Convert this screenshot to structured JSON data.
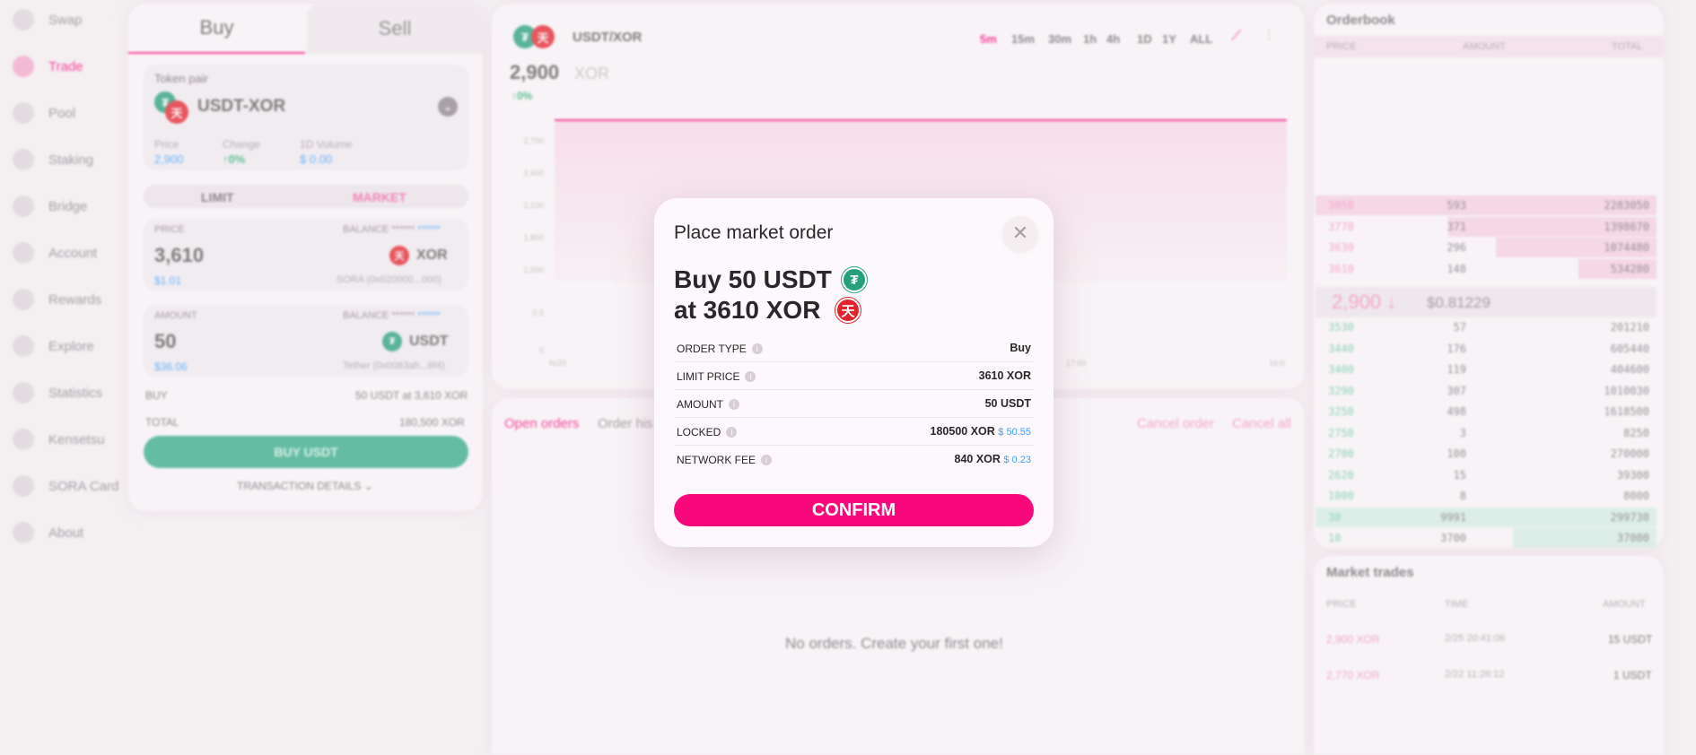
{
  "sidebar": {
    "items": [
      {
        "label": "Swap",
        "icon": "swap-icon"
      },
      {
        "label": "Trade",
        "icon": "trade-icon",
        "active": true
      },
      {
        "label": "Pool",
        "icon": "pool-icon"
      },
      {
        "label": "Staking",
        "icon": "staking-icon"
      },
      {
        "label": "Bridge",
        "icon": "bridge-icon"
      },
      {
        "label": "Account",
        "icon": "account-icon"
      },
      {
        "label": "Rewards",
        "icon": "rewards-icon"
      },
      {
        "label": "Explore",
        "icon": "explore-icon"
      },
      {
        "label": "Statistics",
        "icon": "statistics-icon"
      },
      {
        "label": "Kensetsu",
        "icon": "kensetsu-icon"
      },
      {
        "label": "SORA Card",
        "icon": "card-icon"
      },
      {
        "label": "About",
        "icon": "about-icon"
      }
    ]
  },
  "order_form": {
    "buy_tab": "Buy",
    "sell_tab": "Sell",
    "token_pair_label": "Token pair",
    "token_pair": "USDT-XOR",
    "price_label": "Price",
    "price_value": "2,900",
    "change_label": "Change",
    "change_value": "0%",
    "volume_label": "1D Volume",
    "volume_value": "0.00",
    "volume_prefix": "$",
    "limit_tab": "LIMIT",
    "market_tab": "MARKET",
    "price_field_label": "PRICE",
    "balance_label": "BALANCE",
    "balance_mask": "******",
    "balance_mask_blue": "******",
    "price_input": "3,610",
    "price_usd": "$1.01",
    "price_token": "XOR",
    "price_token_info": "SORA (0x020000...000)",
    "amount_field_label": "AMOUNT",
    "amount_input": "50",
    "amount_usd": "$36.06",
    "amount_token": "USDT",
    "amount_token_info": "Tether (0x0083ah...6f4)",
    "summary_buy_label": "BUY",
    "summary_buy_value": "50 USDT at 3,610 XOR",
    "summary_total_label": "TOTAL",
    "summary_total_value": "180,500 XOR",
    "buy_button": "BUY USDT",
    "transaction_details": "TRANSACTION DETAILS"
  },
  "chart": {
    "pair": "USDT/XOR",
    "price": "2,900",
    "price_unit": "XOR",
    "change": "0%",
    "timeframes": [
      "5m",
      "15m",
      "30m",
      "1h",
      "4h",
      "1D",
      "1Y",
      "ALL"
    ],
    "active_timeframe": "5m",
    "colors": {
      "accent": "#f8087b",
      "fill": "#f6c2d9"
    }
  },
  "chart_data": {
    "type": "area",
    "y_ticks": [
      "2,700",
      "2,400",
      "2,100",
      "1,800",
      "1,500",
      "0.5",
      "0"
    ],
    "x_ticks": [
      "N/20",
      "17:00",
      "16:0"
    ],
    "values": [
      2900,
      2900
    ],
    "title": ""
  },
  "orders": {
    "open_orders_tab": "Open orders",
    "order_history_tab": "Order his",
    "cancel_order": "Cancel order",
    "cancel_all": "Cancel all",
    "empty_text": "No orders. Create your first one!"
  },
  "orderbook": {
    "title": "Orderbook",
    "headers": [
      "PRICE",
      "AMOUNT",
      "TOTAL"
    ],
    "asks": [
      {
        "price": "3850",
        "amount": "593",
        "total": "2283050",
        "depth": 1.0
      },
      {
        "price": "3770",
        "amount": "371",
        "total": "1398670",
        "depth": 0.61
      },
      {
        "price": "3630",
        "amount": "296",
        "total": "1074480",
        "depth": 0.47
      },
      {
        "price": "3610",
        "amount": "148",
        "total": "534280",
        "depth": 0.23
      }
    ],
    "mid_price": "2,900",
    "mid_usd": "$0.81229",
    "bids": [
      {
        "price": "3530",
        "amount": "57",
        "total": "201210",
        "depth": 0
      },
      {
        "price": "3440",
        "amount": "176",
        "total": "605440",
        "depth": 0
      },
      {
        "price": "3400",
        "amount": "119",
        "total": "404600",
        "depth": 0
      },
      {
        "price": "3290",
        "amount": "307",
        "total": "1010030",
        "depth": 0
      },
      {
        "price": "3250",
        "amount": "498",
        "total": "1618500",
        "depth": 0
      },
      {
        "price": "2750",
        "amount": "3",
        "total": "8250",
        "depth": 0
      },
      {
        "price": "2700",
        "amount": "100",
        "total": "270000",
        "depth": 0
      },
      {
        "price": "2620",
        "amount": "15",
        "total": "39300",
        "depth": 0
      },
      {
        "price": "1000",
        "amount": "8",
        "total": "8000",
        "depth": 0
      },
      {
        "price": "30",
        "amount": "9991",
        "total": "299730",
        "depth": 1.0
      },
      {
        "price": "10",
        "amount": "3700",
        "total": "37000",
        "depth": 0.42
      }
    ]
  },
  "market_trades": {
    "title": "Market trades",
    "headers": [
      "PRICE",
      "TIME",
      "AMOUNT"
    ],
    "rows": [
      {
        "price": "2,900 XOR",
        "time": "2/25 20:41:06",
        "amount": "15 USDT"
      },
      {
        "price": "2,770 XOR",
        "time": "2/22 11:26:12",
        "amount": "1 USDT"
      }
    ]
  },
  "modal": {
    "title": "Place market order",
    "headline_1": "Buy 50 USDT",
    "headline_2": "at 3610 XOR",
    "rows": [
      {
        "label": "ORDER TYPE",
        "value": "Buy"
      },
      {
        "label": "LIMIT PRICE",
        "value": "3610 XOR"
      },
      {
        "label": "AMOUNT",
        "value": "50 USDT"
      },
      {
        "label": "LOCKED",
        "value": "180500 XOR",
        "usd": "$ 50.55"
      },
      {
        "label": "NETWORK FEE",
        "value": "840 XOR",
        "usd": "$ 0.23"
      }
    ],
    "confirm_button": "CONFIRM",
    "colors": {
      "primary": "#f8087b",
      "buy": "#2ab076",
      "usd": "#3aa1ff"
    }
  }
}
